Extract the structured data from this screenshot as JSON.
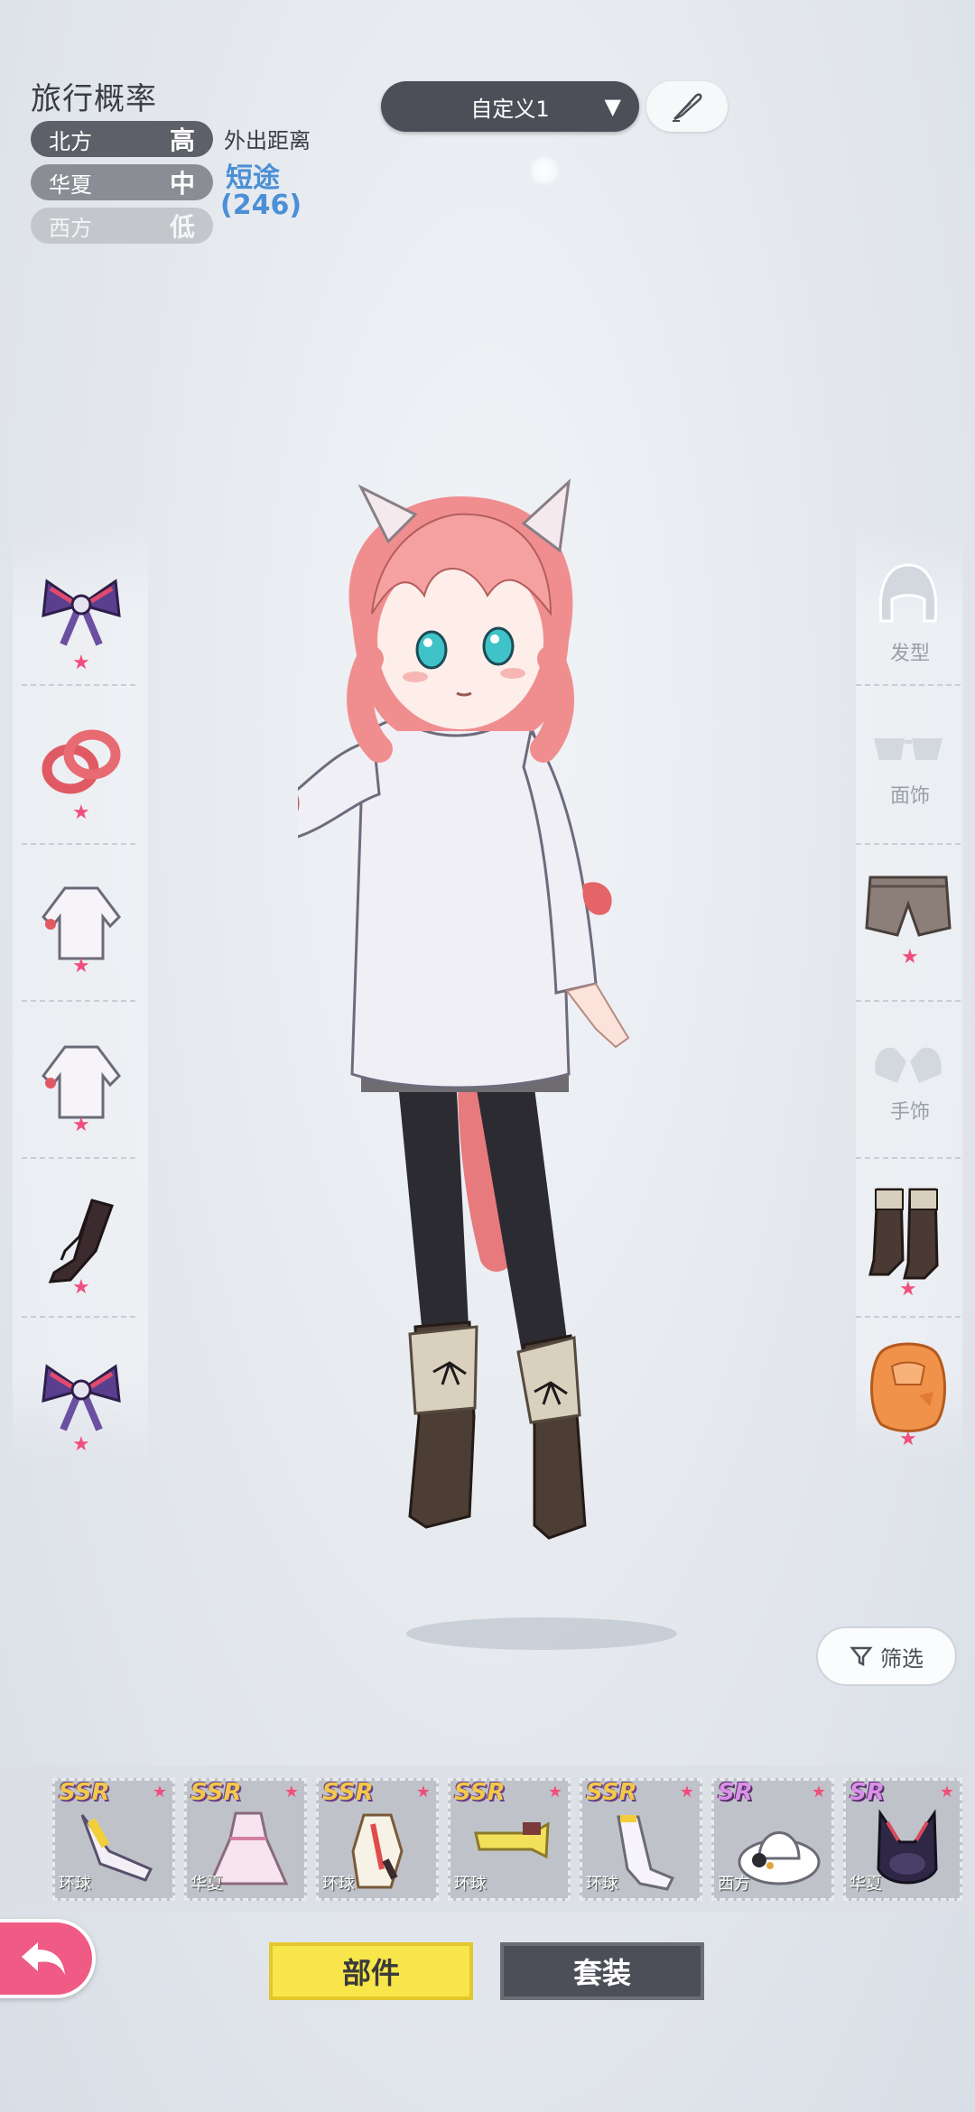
{
  "travel": {
    "title": "旅行概率",
    "rows": [
      {
        "region": "北方",
        "level": "高"
      },
      {
        "region": "华夏",
        "level": "中"
      },
      {
        "region": "西方",
        "level": "低"
      }
    ],
    "distance_label": "外出距离",
    "distance_value": "短途",
    "distance_count": "(246)"
  },
  "preset": {
    "label": "自定义1",
    "arrow": "▼"
  },
  "right_categories": {
    "hair": "发型",
    "face": "面饰",
    "hand": "手饰"
  },
  "filter": {
    "label": "筛选"
  },
  "items": [
    {
      "rarity": "SSR",
      "origin": "环球"
    },
    {
      "rarity": "SSR",
      "origin": "华夏"
    },
    {
      "rarity": "SSR",
      "origin": "环球"
    },
    {
      "rarity": "SSR",
      "origin": "环球"
    },
    {
      "rarity": "SSR",
      "origin": "环球"
    },
    {
      "rarity": "SR",
      "origin": "西方"
    },
    {
      "rarity": "SR",
      "origin": "华夏"
    }
  ],
  "tabs": {
    "parts": "部件",
    "sets": "套装"
  },
  "colors": {
    "accent_pink": "#ef5b84",
    "accent_yellow": "#f8e64a",
    "distance_blue": "#4b8fd6",
    "dark_button": "#4c4f57"
  }
}
